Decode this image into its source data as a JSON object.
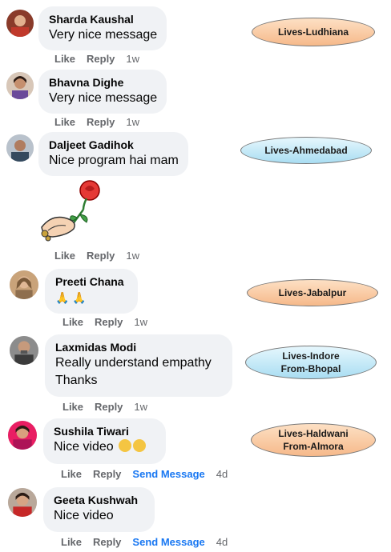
{
  "comments": [
    {
      "author": "Sharda Kaushal",
      "text": "Very nice message",
      "like": "Like",
      "reply": "Reply",
      "time": "1w"
    },
    {
      "author": "Bhavna Dighe",
      "text": "Very nice message",
      "like": "Like",
      "reply": "Reply",
      "time": "1w"
    },
    {
      "author": "Daljeet Gadihok",
      "text": "Nice program hai mam",
      "like": "Like",
      "reply": "Reply",
      "time": "1w",
      "sticker": "hand-holding-rose"
    },
    {
      "author": "Preeti Chana",
      "text": "🙏 🙏",
      "like": "Like",
      "reply": "Reply",
      "time": "1w"
    },
    {
      "author": "Laxmidas Modi",
      "text_line1": "Really understand empathy",
      "text_line2": "Thanks",
      "like": "Like",
      "reply": "Reply",
      "time": "1w"
    },
    {
      "author": "Sushila Tiwari",
      "text": "Nice video",
      "like": "Like",
      "reply": "Reply",
      "send": "Send Message",
      "time": "4d",
      "emoji": "clapping-hands"
    },
    {
      "author": "Geeta Kushwah",
      "text": "Nice video",
      "like": "Like",
      "reply": "Reply",
      "send": "Send Message",
      "time": "4d"
    }
  ],
  "tags": [
    {
      "line1": "Lives-Ludhiana",
      "color": "#f6b98a"
    },
    {
      "line1": "Lives-Ahmedabad",
      "color": "#a9ddf2"
    },
    {
      "line1": "Lives-Jabalpur",
      "color": "#f6b98a"
    },
    {
      "line1": "Lives-Indore",
      "line2": "From-Bhopal",
      "color": "#a9ddf2"
    },
    {
      "line1": "Lives-Haldwani",
      "line2": "From-Almora",
      "color": "#f6b98a"
    }
  ]
}
